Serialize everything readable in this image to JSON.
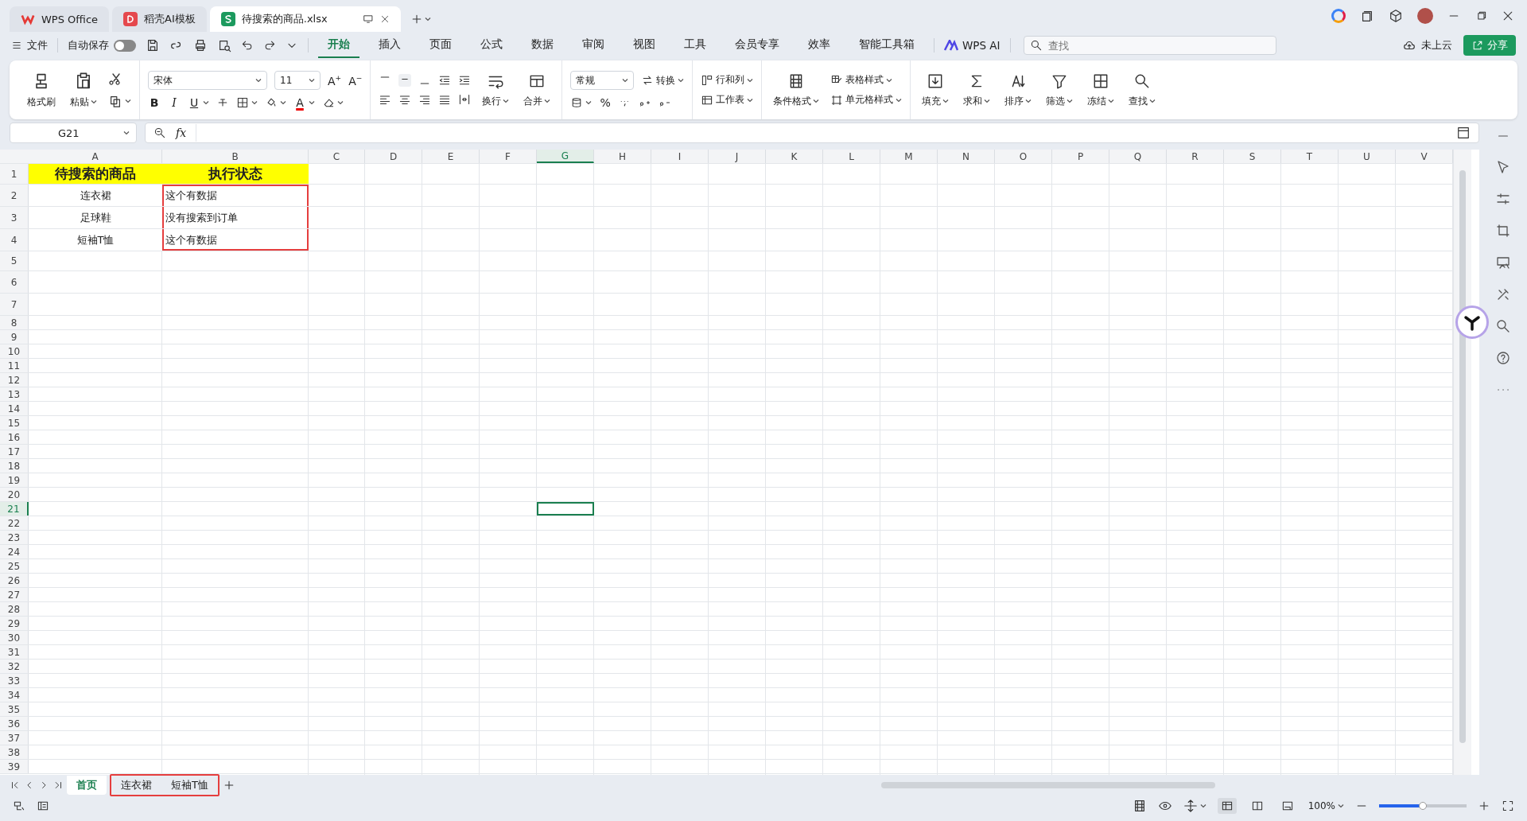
{
  "title_tabs": [
    {
      "label": "WPS Office",
      "kind": "wps",
      "selected": false
    },
    {
      "label": "稻壳AI模板",
      "kind": "docer",
      "selected": false
    },
    {
      "label": "待搜索的商品.xlsx",
      "kind": "sheet",
      "selected": true
    }
  ],
  "menu_bar": {
    "file": "文件",
    "autosave": {
      "label": "自动保存",
      "on": false
    },
    "tabs": [
      {
        "label": "开始",
        "selected": true
      },
      {
        "label": "插入",
        "selected": false
      },
      {
        "label": "页面",
        "selected": false
      },
      {
        "label": "公式",
        "selected": false
      },
      {
        "label": "数据",
        "selected": false
      },
      {
        "label": "审阅",
        "selected": false
      },
      {
        "label": "视图",
        "selected": false
      },
      {
        "label": "工具",
        "selected": false
      },
      {
        "label": "会员专享",
        "selected": false
      },
      {
        "label": "效率",
        "selected": false
      },
      {
        "label": "智能工具箱",
        "selected": false
      }
    ],
    "wps_ai": "WPS AI",
    "search": {
      "placeholder": "查找"
    },
    "cloud": "未上云",
    "share": "分享"
  },
  "ribbon": {
    "format_painter": "格式刷",
    "paste": "粘贴",
    "font": {
      "name": "宋体",
      "size": "11",
      "grow": "A$^{+}$",
      "shrink": "A$^{−}$",
      "bold": "B",
      "italic": "I",
      "underline": "U",
      "font_color": "A"
    },
    "wrap": "换行",
    "merge": "合并",
    "number": {
      "format": "常规",
      "convert": "转换",
      "percent": "%"
    },
    "rows_columns": "行和列",
    "worksheet": "工作表",
    "conditional_format": "条件格式",
    "table_style": "表格样式",
    "cell_style": "单元格样式",
    "tools": [
      "填充",
      "求和",
      "排序",
      "筛选",
      "冻结",
      "查找"
    ]
  },
  "formula_bar": {
    "name_box": "G21",
    "fx": "fx"
  },
  "sheet": {
    "columns": [
      {
        "label": "A",
        "selected": false
      },
      {
        "label": "B",
        "selected": false
      },
      {
        "label": "C",
        "selected": false
      },
      {
        "label": "D",
        "selected": false
      },
      {
        "label": "E",
        "selected": false
      },
      {
        "label": "F",
        "selected": false
      },
      {
        "label": "G",
        "selected": true
      },
      {
        "label": "H",
        "selected": false
      },
      {
        "label": "I",
        "selected": false
      },
      {
        "label": "J",
        "selected": false
      },
      {
        "label": "K",
        "selected": false
      },
      {
        "label": "L",
        "selected": false
      },
      {
        "label": "M",
        "selected": false
      },
      {
        "label": "N",
        "selected": false
      },
      {
        "label": "O",
        "selected": false
      },
      {
        "label": "P",
        "selected": false
      },
      {
        "label": "Q",
        "selected": false
      },
      {
        "label": "R",
        "selected": false
      },
      {
        "label": "S",
        "selected": false
      },
      {
        "label": "T",
        "selected": false
      },
      {
        "label": "U",
        "selected": false
      },
      {
        "label": "V",
        "selected": false
      }
    ],
    "rows": [
      {
        "label": "1",
        "selected": false,
        "cells": [
          {
            "text": "待搜索的商品",
            "kind": "header",
            "marked": false
          },
          {
            "text": "执行状态",
            "kind": "header",
            "marked": false
          }
        ]
      },
      {
        "label": "2",
        "selected": false,
        "cells": [
          {
            "text": "连衣裙",
            "kind": "center",
            "marked": false
          },
          {
            "text": "这个有数据",
            "kind": "left",
            "marked": true
          }
        ]
      },
      {
        "label": "3",
        "selected": false,
        "cells": [
          {
            "text": "足球鞋",
            "kind": "center",
            "marked": false
          },
          {
            "text": "没有搜索到订单",
            "kind": "left",
            "marked": true
          }
        ]
      },
      {
        "label": "4",
        "selected": false,
        "cells": [
          {
            "text": "短袖T恤",
            "kind": "center",
            "marked": false
          },
          {
            "text": "这个有数据",
            "kind": "left",
            "marked": true
          }
        ]
      },
      {
        "label": "5",
        "selected": false
      },
      {
        "label": "6",
        "selected": false
      },
      {
        "label": "7",
        "selected": false
      },
      {
        "label": "8",
        "selected": false
      },
      {
        "label": "9",
        "selected": false
      },
      {
        "label": "10",
        "selected": false
      },
      {
        "label": "11",
        "selected": false
      },
      {
        "label": "12",
        "selected": false
      },
      {
        "label": "13",
        "selected": false
      },
      {
        "label": "14",
        "selected": false
      },
      {
        "label": "15",
        "selected": false
      },
      {
        "label": "16",
        "selected": false
      },
      {
        "label": "17",
        "selected": false
      },
      {
        "label": "18",
        "selected": false
      },
      {
        "label": "19",
        "selected": false
      },
      {
        "label": "20",
        "selected": false
      },
      {
        "label": "21",
        "selected": true
      },
      {
        "label": "22",
        "selected": false
      },
      {
        "label": "23",
        "selected": false
      },
      {
        "label": "24",
        "selected": false
      },
      {
        "label": "25",
        "selected": false
      },
      {
        "label": "26",
        "selected": false
      },
      {
        "label": "27",
        "selected": false
      },
      {
        "label": "28",
        "selected": false
      },
      {
        "label": "29",
        "selected": false
      },
      {
        "label": "30",
        "selected": false
      },
      {
        "label": "31",
        "selected": false
      },
      {
        "label": "32",
        "selected": false
      },
      {
        "label": "33",
        "selected": false
      },
      {
        "label": "34",
        "selected": false
      },
      {
        "label": "35",
        "selected": false
      },
      {
        "label": "36",
        "selected": false
      },
      {
        "label": "37",
        "selected": false
      },
      {
        "label": "38",
        "selected": false
      },
      {
        "label": "39",
        "selected": false
      }
    ]
  },
  "sheet_tabs": [
    {
      "label": "首页",
      "selected": true,
      "marked": false
    },
    {
      "label": "连衣裙",
      "selected": false,
      "marked": true
    },
    {
      "label": "短袖T恤",
      "selected": false,
      "marked": true
    }
  ],
  "status_bar": {
    "view_modes": [
      {
        "kind": "normal",
        "selected": true
      },
      {
        "kind": "page_break",
        "selected": false
      },
      {
        "kind": "reading",
        "selected": false
      }
    ],
    "zoom": "100%",
    "zoom_slider": {
      "level": 0.5
    }
  }
}
